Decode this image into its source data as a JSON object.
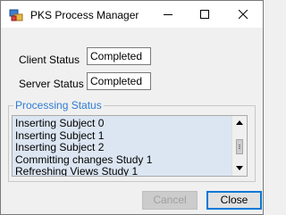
{
  "window": {
    "title": "PKS Process Manager",
    "accent_color": "#0078d7"
  },
  "titlebar": {
    "icon": "app-window-icon",
    "minimize_icon": "minimize-icon",
    "maximize_icon": "maximize-icon",
    "close_icon": "close-icon"
  },
  "status": {
    "client_label": "Client Status",
    "client_value": "Completed",
    "server_label": "Server Status",
    "server_value": "Completed"
  },
  "processing": {
    "legend": "Processing Status",
    "legend_color": "#2f7bd4",
    "list_background": "#dce6f2",
    "items": [
      "Inserting Subject 0",
      "Inserting Subject 1",
      "Inserting Subject 2",
      "Committing changes Study 1",
      "Refreshing Views Study 1"
    ]
  },
  "buttons": {
    "cancel_label": "Cancel",
    "cancel_enabled": false,
    "close_label": "Close"
  }
}
